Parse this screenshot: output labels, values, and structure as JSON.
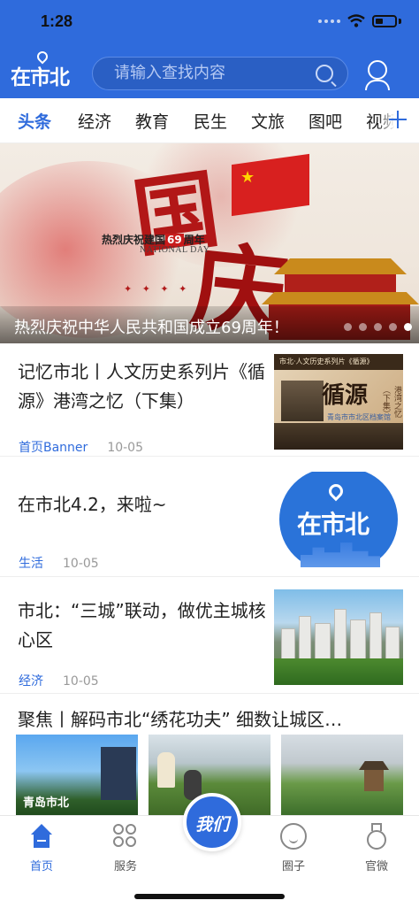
{
  "status_bar": {
    "time": "1:28"
  },
  "header": {
    "logo_text": "在市北",
    "search_placeholder": "请输入查找内容",
    "brand_color": "#2f6bdc"
  },
  "tabs": [
    {
      "label": "头条",
      "active": true
    },
    {
      "label": "经济"
    },
    {
      "label": "教育"
    },
    {
      "label": "民生"
    },
    {
      "label": "文旅"
    },
    {
      "label": "图吧"
    },
    {
      "label": "视频"
    }
  ],
  "banner": {
    "caption": "热烈庆祝中华人民共和国成立69周年！",
    "art_char_1": "国",
    "art_char_2": "庆",
    "art_subtitle_pre": "热烈庆祝建国",
    "art_subtitle_num": "69",
    "art_subtitle_post": "周年",
    "art_en": "NATIONAL DAY",
    "dot_count": 5,
    "active_dot": 5
  },
  "news": [
    {
      "title": "记忆市北丨人文历史系列片《循源》港湾之忆（下集）",
      "tag": "首页Banner",
      "date": "10-05",
      "thumb_band": "市北·人文历史系列片《循源》",
      "thumb_title": "循源",
      "thumb_side": "港湾之忆（下集）",
      "thumb_sub": "青岛市市北区档案馆"
    },
    {
      "title": "在市北4.2，来啦~",
      "tag": "生活",
      "date": "10-05",
      "thumb_logo": "在市北"
    },
    {
      "title": "市北：“三城”联动，做优主城核心区",
      "tag": "经济",
      "date": "10-05"
    }
  ],
  "gallery": {
    "title": "聚焦丨解码市北“绣花功夫” 细数让城区…",
    "first_image_caption": "青岛市北"
  },
  "bottom_nav": {
    "items": [
      {
        "label": "首页",
        "active": true
      },
      {
        "label": "服务"
      },
      {
        "label": "圈子"
      },
      {
        "label": "官微"
      }
    ],
    "center_label": "我们"
  }
}
